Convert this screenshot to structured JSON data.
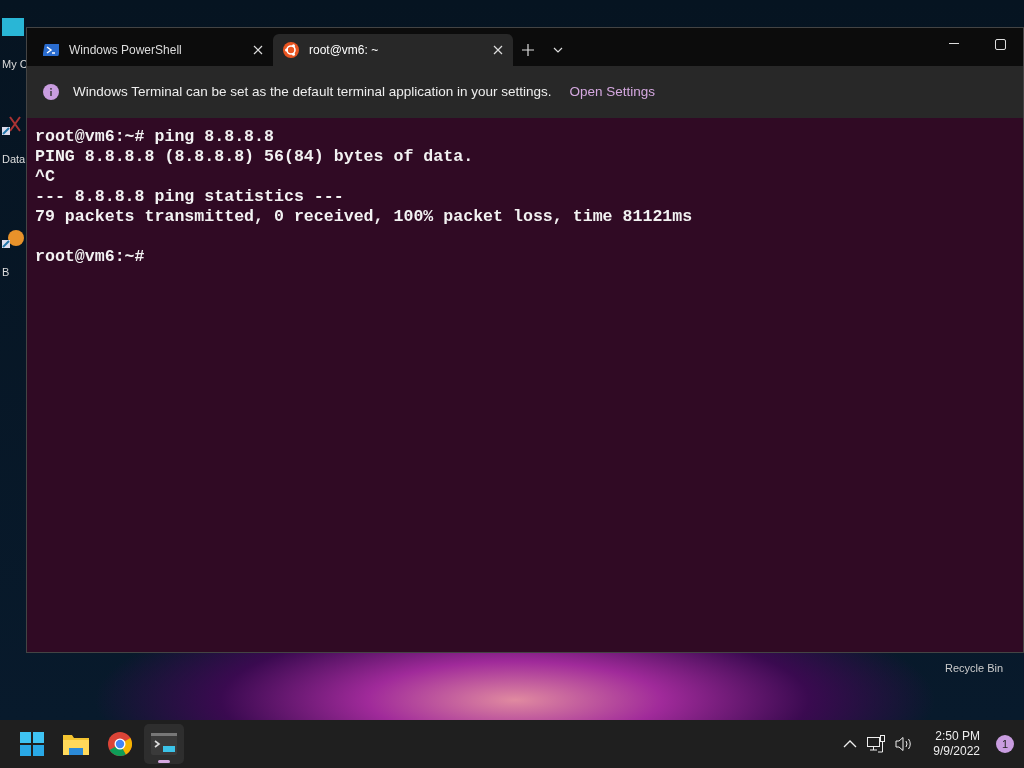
{
  "desktop_icons": [
    {
      "label": "My C",
      "kind": "computer"
    },
    {
      "label": "Data",
      "kind": "data"
    },
    {
      "label": "B",
      "kind": "app"
    },
    {
      "label": "Recycle Bin",
      "kind": "bin"
    }
  ],
  "window": {
    "tabs": [
      {
        "label": "Windows PowerShell",
        "selected": false,
        "kind": "powershell"
      },
      {
        "label": "root@vm6: ~",
        "selected": true,
        "kind": "ubuntu"
      }
    ],
    "infobar": {
      "message": "Windows Terminal can be set as the default terminal application in your settings.",
      "link": "Open Settings"
    },
    "terminal_blocks": [
      {
        "lines": [
          "root@vm6:~# ping 8.8.8.8",
          "PING 8.8.8.8 (8.8.8.8) 56(84) bytes of data.",
          "^C",
          "--- 8.8.8.8 ping statistics ---",
          "79 packets transmitted, 0 received, 100% packet loss, time 81121ms"
        ]
      },
      {
        "lines": [
          "root@vm6:~#"
        ]
      }
    ]
  },
  "taskbar": {
    "apps": [
      {
        "kind": "start",
        "active": false
      },
      {
        "kind": "explorer",
        "active": false
      },
      {
        "kind": "chrome",
        "active": false
      },
      {
        "kind": "terminal",
        "active": true
      }
    ],
    "time": "2:50 PM",
    "date": "9/9/2022",
    "notifications": "1"
  }
}
